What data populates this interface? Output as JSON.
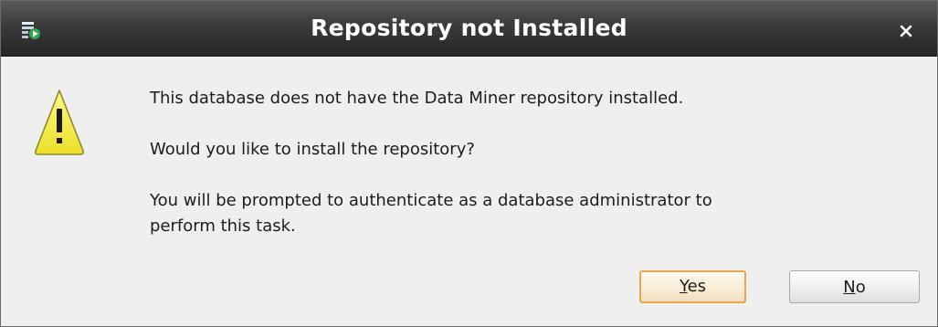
{
  "dialog": {
    "title": "Repository not Installed",
    "icon": "warning-icon",
    "message_line1": "This database does not have the Data Miner repository installed.",
    "message_line2": "Would you like to install the repository?",
    "message_line3a": "You will be prompted to authenticate as a database administrator to",
    "message_line3b": "perform this task.",
    "buttons": {
      "yes": {
        "mnemonic": "Y",
        "rest": "es"
      },
      "no": {
        "mnemonic": "N",
        "rest": "o"
      }
    }
  },
  "colors": {
    "titlebar": "#333333",
    "title_text": "#ffffff",
    "dialog_bg": "#efefef",
    "warning_fill": "#f5f04a",
    "default_button_border": "#e6a74e"
  }
}
